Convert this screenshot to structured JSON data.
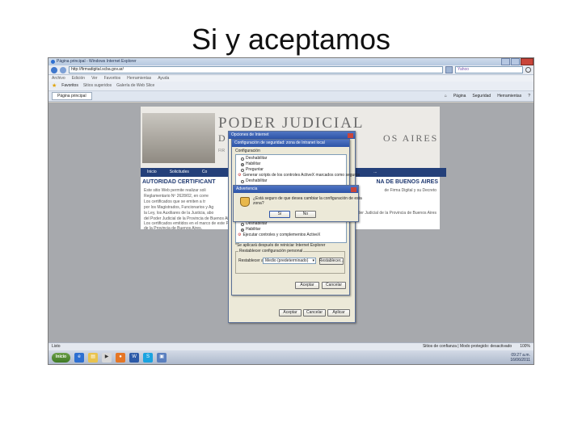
{
  "slide_title": "Si   y aceptamos",
  "window": {
    "title": "Página principal - Windows Internet Explorer",
    "address": "http://firmadigital.scba.gov.ar/",
    "search_placeholder": "Yahoo",
    "menu": [
      "Archivo",
      "Edición",
      "Ver",
      "Favoritos",
      "Herramientas",
      "Ayuda"
    ],
    "favorites_label": "Favoritos",
    "favorites_links": [
      "Sitios sugeridos",
      "Galería de Web Slice"
    ],
    "tab_label": "Página principal",
    "command_bar": [
      "Página",
      "Seguridad",
      "Herramientas"
    ]
  },
  "page": {
    "brand_line1": "PODER JUDICIAL",
    "brand_line2_left": "D",
    "brand_line2_right": "OS AIRES",
    "brand_line3": "FIR",
    "nav": [
      "Inicio",
      "Solicitudes",
      "Co",
      "..."
    ],
    "heading_left": "AUTORIDAD CERTIFICANT",
    "heading_right": "NA DE BUENOS AIRES",
    "para_line1_left": "Este sitio Web permite realizar soli",
    "para_line1_right": "de Firma Digital y su Decreto",
    "para_line2_left": "Reglamentario Nº 2628/02, en corre",
    "para_line3_left": "Los certificados que se emiten a tr",
    "para_line4_left": "por los Magistrados, Funcionarios y Ag",
    "para_line5_left": "la Ley, los Auxiliares de la Justicia, abo",
    "para_line5_right": "Poder Judicial de la Provincia de Buenos Aires",
    "para_line6_left": "del Poder Judicial de la Provincia de Buenos Aires",
    "para_line7_left": "Los certificados emitidos en el marco de este Proyecto...",
    "para_line8_left": "de la Provincia de Buenos Aires."
  },
  "internet_options": {
    "title": "Opciones de Internet",
    "inner_title": "Configuración de seguridad: zona de Intranet local",
    "config_label": "Configuración",
    "items_top": [
      "Deshabilitar",
      "Habilitar",
      "Preguntar",
      "Generar scripts de los controles ActiveX marcados como seguros",
      "Deshabilitar"
    ],
    "items_bottom": [
      "Deshabilitar",
      "Habilitar",
      "Ejecutar controles y complementos ActiveX"
    ],
    "note": "*Se aplicará después de reiniciar Internet Explorer",
    "custom_group": "Restablecer configuración personal",
    "reset_to": "Restablecer a:",
    "reset_value": "Medio (predeterminado)",
    "reset_button": "Restablecer...",
    "accept_button": "Aceptar",
    "cancel_button": "Cancelar",
    "bottom_accept": "Aceptar",
    "bottom_cancel": "Cancelar",
    "bottom_apply": "Aplicar"
  },
  "warning": {
    "title": "Advertencia",
    "message_line1": "¿Está seguro de que desea cambiar la configuración de esta",
    "message_line2": "zona?",
    "yes_button": "Sí",
    "no_button": "No"
  },
  "status": {
    "left": "Listo",
    "zone": "Sitios de confianza | Modo protegido: desactivado",
    "zoom": "100%"
  },
  "taskbar": {
    "start": "Inicio",
    "time": "09:27 a.m.",
    "date": "16/06/2011"
  }
}
